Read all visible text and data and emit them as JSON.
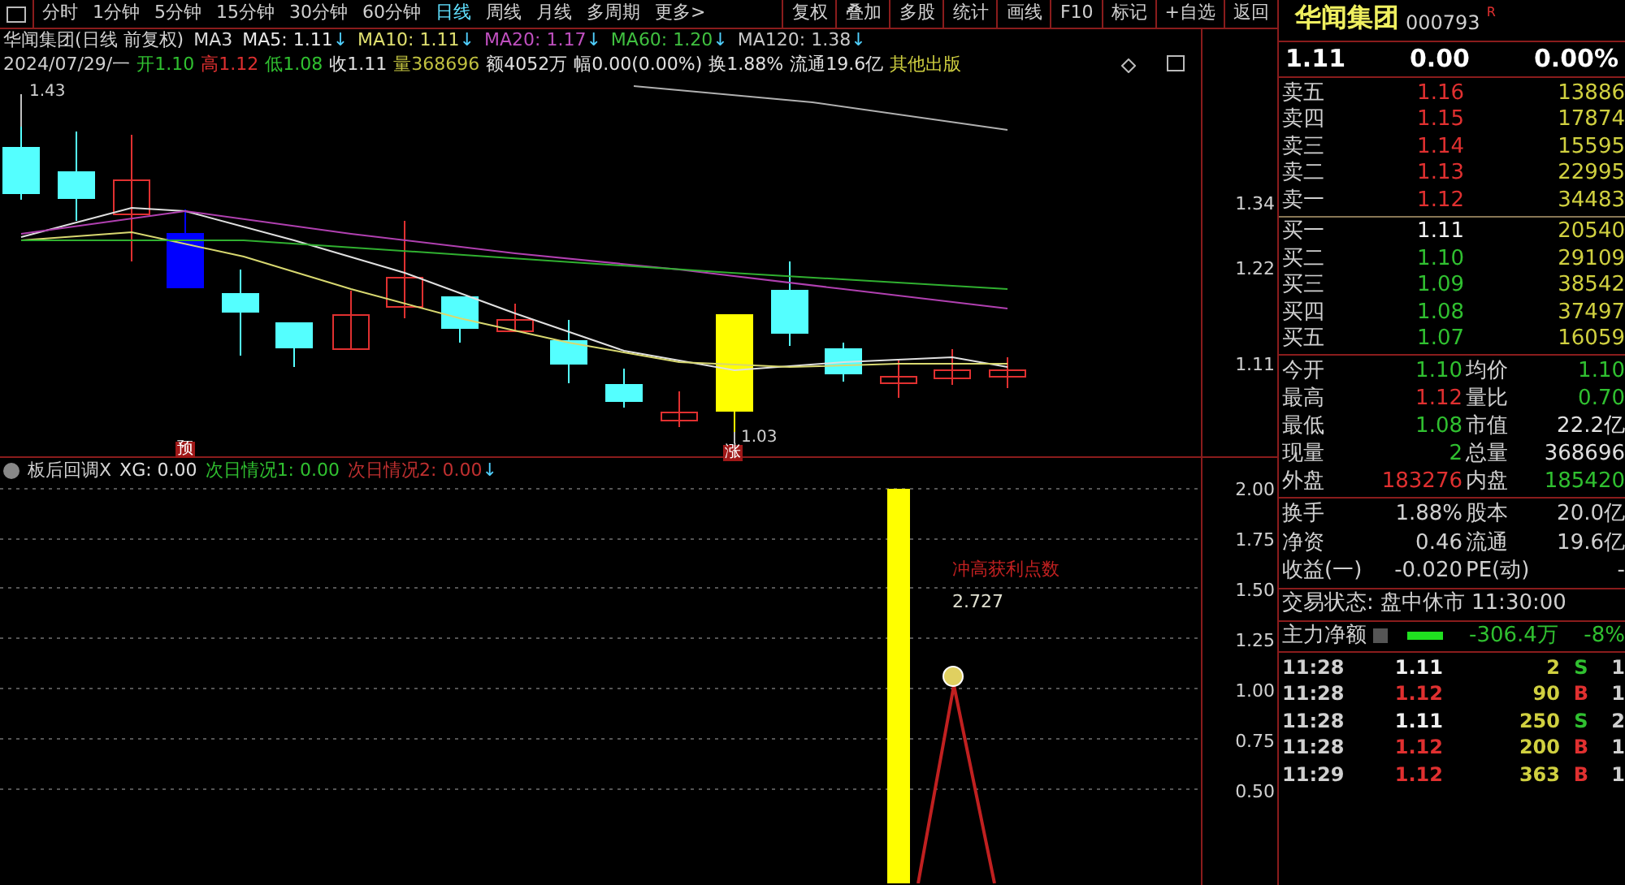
{
  "period_tabs": [
    {
      "label": "分时",
      "selected": false
    },
    {
      "label": "1分钟",
      "selected": false
    },
    {
      "label": "5分钟",
      "selected": false
    },
    {
      "label": "15分钟",
      "selected": false
    },
    {
      "label": "30分钟",
      "selected": false
    },
    {
      "label": "60分钟",
      "selected": false
    },
    {
      "label": "日线",
      "selected": true
    },
    {
      "label": "周线",
      "selected": false
    },
    {
      "label": "月线",
      "selected": false
    },
    {
      "label": "多周期",
      "selected": false
    },
    {
      "label": "更多>",
      "selected": false
    }
  ],
  "toolbar_buttons": [
    "复权",
    "叠加",
    "多股",
    "统计",
    "画线",
    "F10",
    "标记",
    "+自选",
    "返回"
  ],
  "chart_header": {
    "title": "华闻集团(日线 前复权)",
    "ma": [
      {
        "label": "MA3",
        "color": "#d8d8d8"
      },
      {
        "label": "MA5: 1.11",
        "arrow": "↓",
        "color": "#e8e8e8"
      },
      {
        "label": "MA10: 1.11",
        "arrow": "↓",
        "color": "#e0e070"
      },
      {
        "label": "MA20: 1.17",
        "arrow": "↓",
        "color": "#c050c0"
      },
      {
        "label": "MA60: 1.20",
        "arrow": "↓",
        "color": "#40c040"
      },
      {
        "label": "MA120: 1.38",
        "arrow": "↓",
        "color": "#c8c8c8"
      }
    ]
  },
  "quote_line": {
    "date": "2024/07/29/一",
    "items": [
      {
        "label": "开",
        "value": "1.10",
        "color": "#30c030"
      },
      {
        "label": "高",
        "value": "1.12",
        "color": "#e03030"
      },
      {
        "label": "低",
        "value": "1.08",
        "color": "#30c030"
      },
      {
        "label": "收",
        "value": "1.11",
        "color": "#e0e0e0"
      },
      {
        "label": "量",
        "value": "368696",
        "color": "#c0c040"
      },
      {
        "label": "额",
        "value": "4052万",
        "color": "#e0e0e0"
      },
      {
        "label": "幅",
        "value": "0.00(0.00%)",
        "color": "#e0e0e0"
      },
      {
        "label": "换",
        "value": "1.88%",
        "color": "#e0e0e0"
      },
      {
        "label": "流通",
        "value": "19.6亿",
        "color": "#e0e0e0"
      }
    ],
    "extra": "其他出版"
  },
  "price_chart": {
    "axis_labels": [
      "1.34",
      "1.22",
      "1.11"
    ],
    "high_label": "1.43",
    "low_label": "1.03",
    "markers": [
      "预",
      "涨"
    ]
  },
  "indicator": {
    "name": "板后回调X",
    "values": [
      {
        "text": "XG: 0.00",
        "color": "#e0e0e0"
      },
      {
        "text": "次日情况1: 0.00",
        "color": "#30c030"
      },
      {
        "text": "次日情况2: 0.00",
        "color": "#c03030"
      }
    ],
    "arrow": "↓",
    "axis_labels": [
      "2.00",
      "1.75",
      "1.50",
      "1.25",
      "1.00",
      "0.75",
      "0.50"
    ],
    "series_label": "冲高获利点数",
    "value_label": "2.727"
  },
  "stock": {
    "name": "华闻集团",
    "code": "000793",
    "badge": "R",
    "price": "1.11",
    "change": "0.00",
    "change_pct": "0.00%"
  },
  "asks": [
    {
      "label": "卖五",
      "price": "1.16",
      "volume": "13886"
    },
    {
      "label": "卖四",
      "price": "1.15",
      "volume": "17874"
    },
    {
      "label": "卖三",
      "price": "1.14",
      "volume": "15595"
    },
    {
      "label": "卖二",
      "price": "1.13",
      "volume": "22995"
    },
    {
      "label": "卖一",
      "price": "1.12",
      "volume": "34483"
    }
  ],
  "bids": [
    {
      "label": "买一",
      "price": "1.11",
      "volume": "20540",
      "color": "#f0f0f0"
    },
    {
      "label": "买二",
      "price": "1.10",
      "volume": "29109",
      "color": "#30c030"
    },
    {
      "label": "买三",
      "price": "1.09",
      "volume": "38542",
      "color": "#30c030"
    },
    {
      "label": "买四",
      "price": "1.08",
      "volume": "37497",
      "color": "#30c030"
    },
    {
      "label": "买五",
      "price": "1.07",
      "volume": "16059",
      "color": "#30c030"
    }
  ],
  "stats": [
    {
      "left": {
        "label": "今开",
        "value": "1.10",
        "color": "#30c030"
      },
      "right": {
        "label": "均价",
        "value": "1.10",
        "color": "#30c030"
      }
    },
    {
      "left": {
        "label": "最高",
        "value": "1.12",
        "color": "#e03030"
      },
      "right": {
        "label": "量比",
        "value": "0.70",
        "color": "#30c030"
      }
    },
    {
      "left": {
        "label": "最低",
        "value": "1.08",
        "color": "#30c030"
      },
      "right": {
        "label": "市值",
        "value": "22.2亿",
        "color": "#e0e0e0"
      }
    },
    {
      "left": {
        "label": "现量",
        "value": "2",
        "color": "#30c030"
      },
      "right": {
        "label": "总量",
        "value": "368696",
        "color": "#e0e0e0"
      }
    },
    {
      "left": {
        "label": "外盘",
        "value": "183276",
        "color": "#e03030"
      },
      "right": {
        "label": "内盘",
        "value": "185420",
        "color": "#30c030"
      }
    }
  ],
  "details": [
    {
      "label": "换手",
      "value": "1.88%",
      "label_2": "股本",
      "value_2": "20.0亿"
    },
    {
      "label": "净资",
      "value": "0.46",
      "label_2": "流通",
      "value_2": "19.6亿"
    },
    {
      "label": "收益(一)",
      "value": "-0.020",
      "label_2": "PE(动)",
      "value_2": "-"
    }
  ],
  "trade_status": {
    "label": "交易状态: 盘中休市",
    "time": "11:30:00"
  },
  "main_flow": {
    "label": "主力净额",
    "value": "-306.4万",
    "pct": "-8%"
  },
  "trades": [
    {
      "time": "11:28",
      "price": "1.11",
      "volume": "2",
      "side": "S",
      "column_5": "1",
      "color": "#f0f0f0"
    },
    {
      "time": "11:28",
      "price": "1.12",
      "volume": "90",
      "side": "B",
      "column_5": "1",
      "color": "#e03030"
    },
    {
      "time": "11:28",
      "price": "1.11",
      "volume": "250",
      "side": "S",
      "column_5": "2",
      "color": "#f0f0f0"
    },
    {
      "time": "11:28",
      "price": "1.12",
      "volume": "200",
      "side": "B",
      "column_5": "1",
      "color": "#e03030"
    },
    {
      "time": "11:29",
      "price": "1.12",
      "volume": "363",
      "side": "B",
      "column_5": "1",
      "color": "#e03030"
    }
  ]
}
